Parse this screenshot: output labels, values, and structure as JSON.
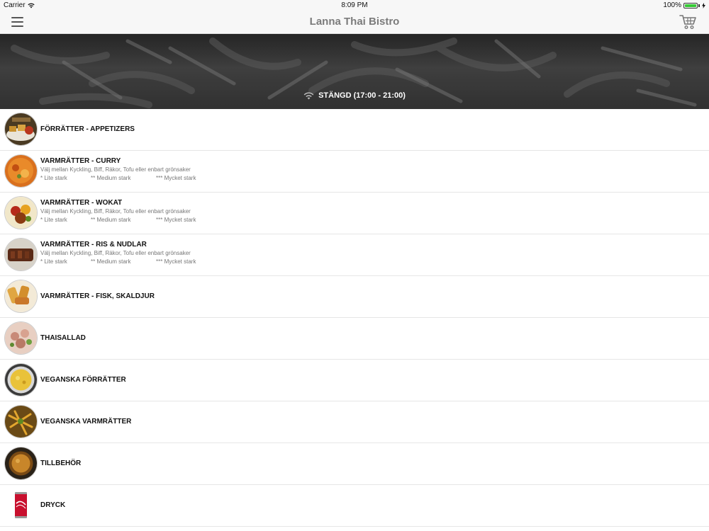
{
  "status_bar": {
    "carrier": "Carrier",
    "time": "8:09 PM",
    "battery": "100%"
  },
  "nav": {
    "title": "Lanna Thai Bistro",
    "menu_icon": "hamburger-menu-icon",
    "cart_icon": "shopping-cart-icon"
  },
  "hero": {
    "status_icon": "wifi-icon",
    "status_text": "STÄNGD (17:00 - 21:00)"
  },
  "categories": [
    {
      "title": "FÖRRÄTTER - APPETIZERS"
    },
    {
      "title": "VARMRÄTTER - CURRY",
      "desc": "Välj mellan Kyckling, Biff, Räkor, Tofu eller enbart grönsaker",
      "heat": [
        "* Lite stark",
        "** Medium stark",
        "*** Mycket stark"
      ]
    },
    {
      "title": "VARMRÄTTER - WOKAT",
      "desc": "Välj mellan Kyckling, Biff, Räkor, Tofu eller enbart grönsaker",
      "heat": [
        "* Lite stark",
        "** Medium stark",
        "*** Mycket stark"
      ]
    },
    {
      "title": "VARMRÄTTER - RIS & NUDLAR",
      "desc": "Välj mellan Kyckling, Biff, Räkor, Tofu eller enbart grönsaker",
      "heat": [
        "* Lite stark",
        "** Medium stark",
        "*** Mycket stark"
      ]
    },
    {
      "title": "VARMRÄTTER - FISK, SKALDJUR"
    },
    {
      "title": "THAISALLAD"
    },
    {
      "title": "VEGANSKA FÖRRÄTTER"
    },
    {
      "title": "VEGANSKA VARMRÄTTER"
    },
    {
      "title": "TILLBEHÖR"
    },
    {
      "title": "DRYCK"
    }
  ],
  "colors": {
    "nav_bg": "#f7f7f7",
    "title_gray": "#7b7b7b",
    "battery_green": "#35c935"
  }
}
